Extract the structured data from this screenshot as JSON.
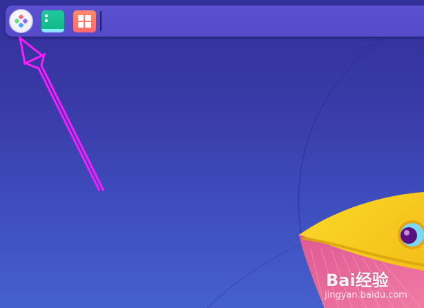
{
  "taskbar": {
    "launcher": {
      "icon": "launcher-icon"
    },
    "pinned_apps": [
      {
        "icon": "file-manager-icon",
        "color": "#1fc99c"
      },
      {
        "icon": "app-center-icon",
        "color": "#ff7a6a"
      }
    ]
  },
  "annotation": {
    "arrow_color": "#ff1aff"
  },
  "watermark": {
    "brand": "Bai经验",
    "domain": "jingyan.baidu.com"
  },
  "colors": {
    "background_top": "#32309a",
    "background_bottom": "#4560cc",
    "taskbar": "#5a50d0",
    "fish_body": "#f6cc1c",
    "fish_fin": "#e0608e"
  }
}
